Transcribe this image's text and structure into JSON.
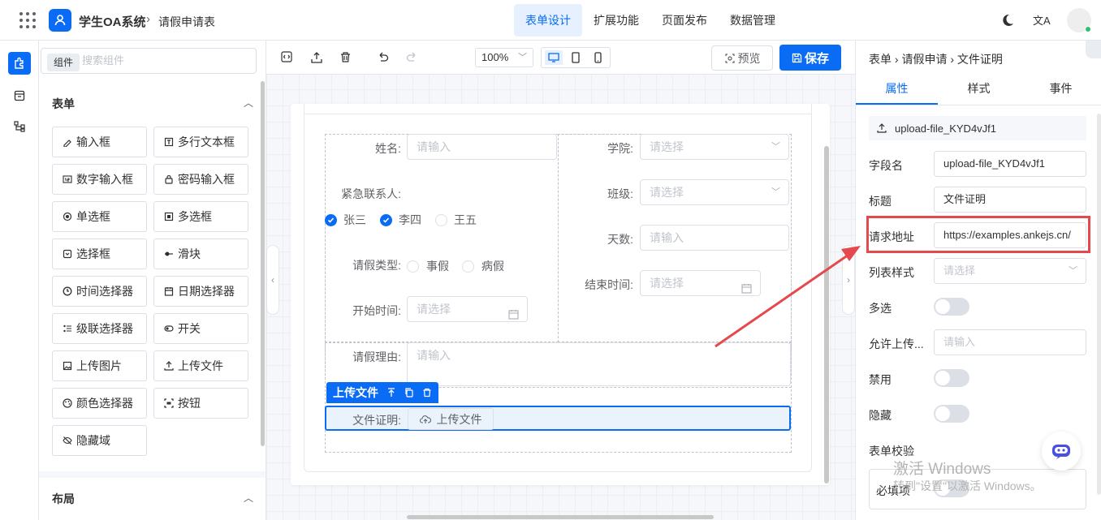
{
  "header": {
    "app_name": "学生OA系统",
    "crumb_sep": "›",
    "page_name": "请假申请表",
    "nav": [
      {
        "label": "表单设计",
        "active": true
      },
      {
        "label": "扩展功能",
        "active": false
      },
      {
        "label": "页面发布",
        "active": false
      },
      {
        "label": "数据管理",
        "active": false
      }
    ],
    "lang_icon": "文A"
  },
  "rail": {
    "tooltip": "组件"
  },
  "palette": {
    "search_placeholder": "搜索组件",
    "section_form": "表单",
    "section_layout": "布局",
    "items": [
      {
        "label": "输入框",
        "icon": "pencil-icon"
      },
      {
        "label": "多行文本框",
        "icon": "textarea-icon"
      },
      {
        "label": "数字输入框",
        "icon": "number-icon"
      },
      {
        "label": "密码输入框",
        "icon": "lock-icon"
      },
      {
        "label": "单选框",
        "icon": "radio-icon"
      },
      {
        "label": "多选框",
        "icon": "checkbox-icon"
      },
      {
        "label": "选择框",
        "icon": "select-icon"
      },
      {
        "label": "滑块",
        "icon": "slider-icon"
      },
      {
        "label": "时间选择器",
        "icon": "clock-icon"
      },
      {
        "label": "日期选择器",
        "icon": "calendar-icon"
      },
      {
        "label": "级联选择器",
        "icon": "cascader-icon"
      },
      {
        "label": "开关",
        "icon": "toggle-icon"
      },
      {
        "label": "上传图片",
        "icon": "image-icon"
      },
      {
        "label": "上传文件",
        "icon": "upload-icon"
      },
      {
        "label": "颜色选择器",
        "icon": "palette-icon"
      },
      {
        "label": "按钮",
        "icon": "button-icon"
      },
      {
        "label": "隐藏域",
        "icon": "eye-off-icon"
      }
    ]
  },
  "toolbar": {
    "zoom": "100%",
    "preview": "预览",
    "save": "保存"
  },
  "form": {
    "name_label": "姓名:",
    "name_ph": "请输入",
    "college_label": "学院:",
    "college_ph": "请选择",
    "contact_label": "紧急联系人:",
    "contacts": [
      {
        "label": "张三",
        "checked": true
      },
      {
        "label": "李四",
        "checked": true
      },
      {
        "label": "王五",
        "checked": false
      }
    ],
    "class_label": "班级:",
    "class_ph": "请选择",
    "days_label": "天数:",
    "days_ph": "请输入",
    "type_label": "请假类型:",
    "types": [
      "事假",
      "病假"
    ],
    "end_label": "结束时间:",
    "end_ph": "请选择",
    "start_label": "开始时间:",
    "start_ph": "请选择",
    "reason_label": "请假理由:",
    "reason_ph": "请输入",
    "selected_tag": "上传文件",
    "file_label": "文件证明:",
    "upload_btn": "上传文件"
  },
  "props": {
    "crumb": "表单 › 请假申请 › 文件证明",
    "tabs": [
      {
        "label": "属性",
        "active": true
      },
      {
        "label": "样式",
        "active": false
      },
      {
        "label": "事件",
        "active": false
      }
    ],
    "id": "upload-file_KYD4vJf1",
    "field_label": "字段名",
    "field_value": "upload-file_KYD4vJf1",
    "title_label": "标题",
    "title_value": "文件证明",
    "url_label": "请求地址",
    "url_value": "https://examples.ankejs.cn/",
    "list_style_label": "列表样式",
    "list_style_ph": "请选择",
    "multi_label": "多选",
    "accept_label": "允许上传...",
    "accept_ph": "请输入",
    "disabled_label": "禁用",
    "hidden_label": "隐藏",
    "validate_label": "表单校验",
    "required_label": "必填项",
    "watermark_title": "激活 Windows",
    "watermark_sub": "转到\"设置\"以激活 Windows。"
  },
  "colors": {
    "accent": "#0a6cf5",
    "highlight": "#e5484d"
  }
}
